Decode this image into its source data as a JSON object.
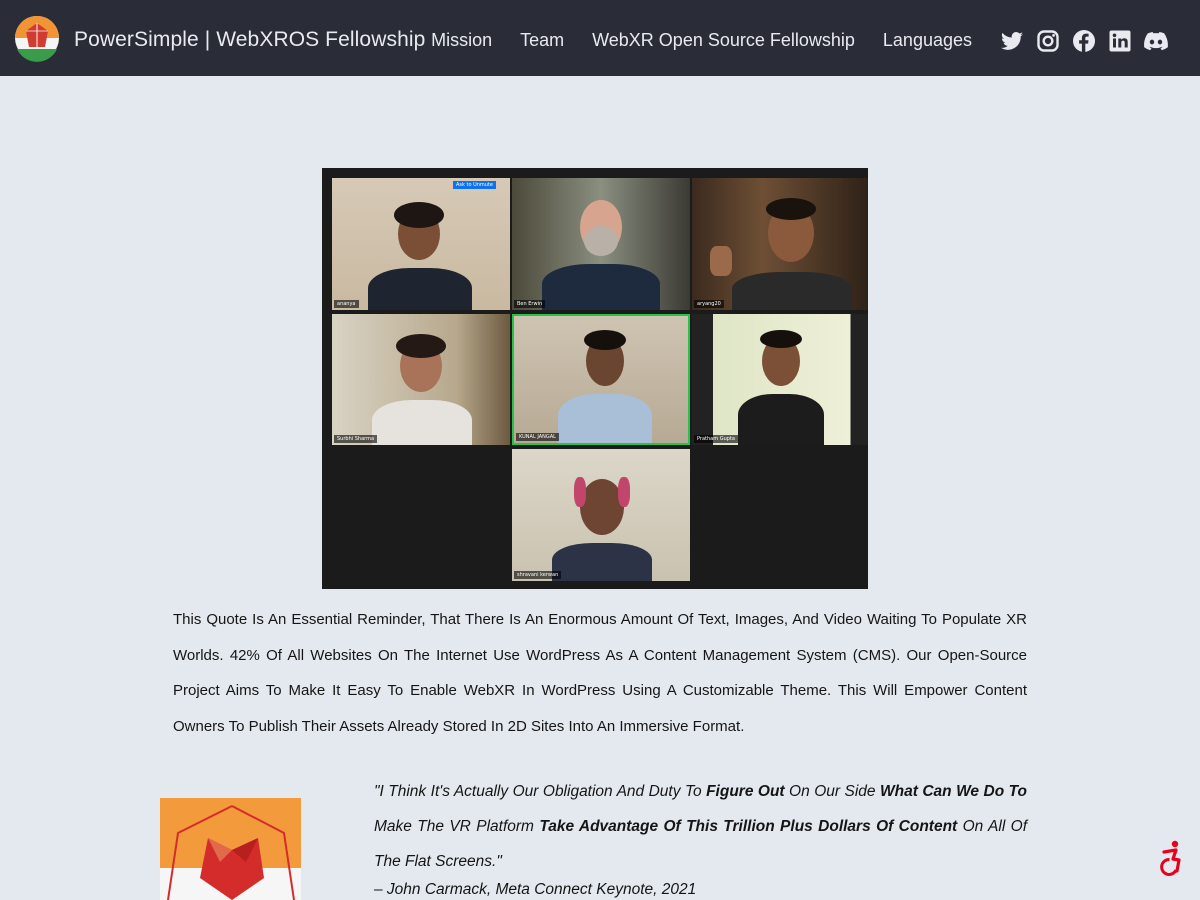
{
  "header": {
    "brand": "PowerSimple | WebXROS Fellowship",
    "nav": [
      "Mission",
      "Team",
      "WebXR Open Source Fellowship",
      "Languages"
    ],
    "social": [
      "twitter-icon",
      "instagram-icon",
      "facebook-icon",
      "linkedin-icon",
      "discord-icon"
    ]
  },
  "photo": {
    "participants": [
      "ananya",
      "Ben Erwin",
      "aryang20",
      "Surbhi Sharma",
      "KUNAL JANGAL",
      "Pratham Gupta",
      "shravani kerwan"
    ],
    "unmute_label": "Ask to Unmute"
  },
  "intro": {
    "text": "This Quote Is An Essential Reminder, That There Is An Enormous Amount Of Text, Images, And Video Waiting To Populate XR Worlds. 42% Of All Websites On The Internet Use WordPress As A Content Management System (CMS).  Our Open-Source Project Aims To Make It Easy To Enable WebXR In WordPress Using A Customizable Theme. This Will Empower Content Owners To Publish Their Assets Already Stored In 2D Sites Into An Immersive Format."
  },
  "quote": {
    "p1": "\"I Think It's Actually Our Obligation And Duty To ",
    "b1": "Figure Out",
    "p2": " On Our Side ",
    "b2": "What Can We Do To",
    "p3": " Make The VR Platform ",
    "b3": "Take Advantage Of This Trillion Plus Dollars Of Content",
    "p4": " On All Of The Flat Screens.\"",
    "attribution": "– John Carmack, Meta Connect Keynote, 2021"
  },
  "colors": {
    "navbar": "#2a2d38",
    "background": "#e4e9ef",
    "accent_orange": "#f39a3d",
    "accent_red": "#d42b2b",
    "accessibility": "#e8001c"
  }
}
